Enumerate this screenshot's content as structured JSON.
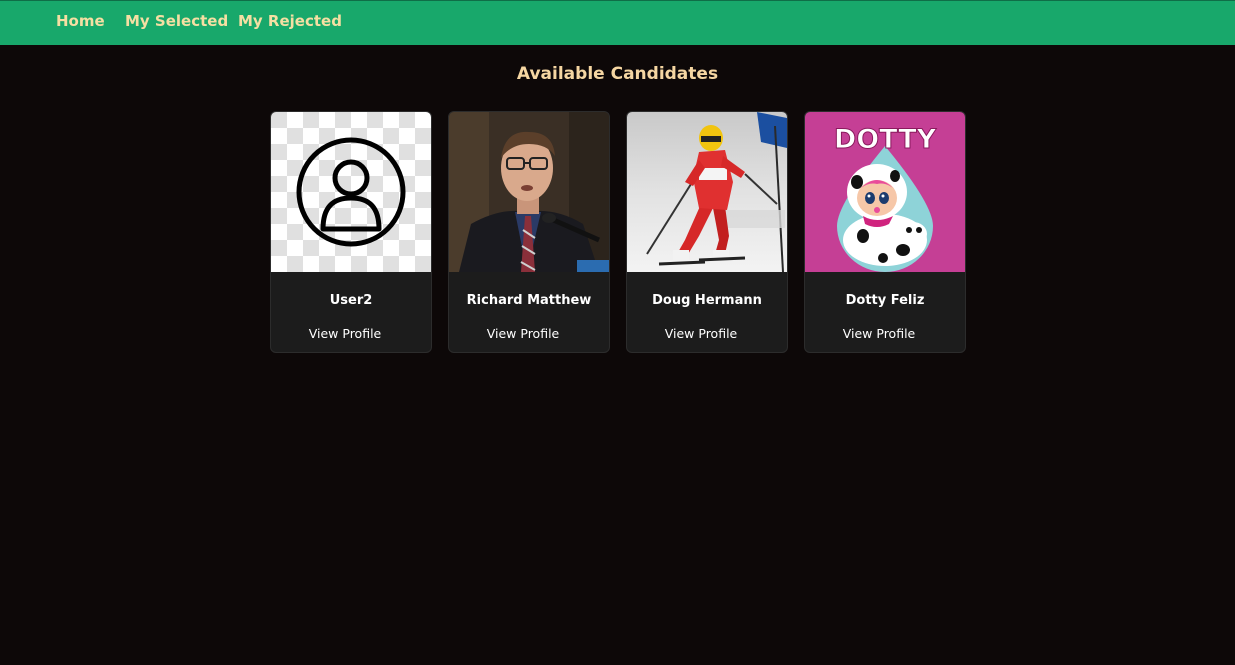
{
  "nav": {
    "home": "Home",
    "selected": "My Selected",
    "rejected": "My Rejected"
  },
  "page": {
    "title": "Available Candidates"
  },
  "candidates": [
    {
      "name": "User2",
      "link": "View Profile",
      "photo": "default-user-avatar"
    },
    {
      "name": "Richard Matthew",
      "link": "View Profile",
      "photo": "man-speaking-at-microphone"
    },
    {
      "name": "Doug Hermann",
      "link": "View Profile",
      "photo": "skier-racing-downhill"
    },
    {
      "name": "Dotty Feliz",
      "photo_text": "DOTTY",
      "link": "View Profile",
      "photo": "cartoon-doll-with-dalmatian"
    }
  ],
  "colors": {
    "navbar": "#18a86b",
    "nav_text": "#f5dfa3",
    "title_text": "#f5d6a2",
    "background": "#0d0808",
    "card": "#1c1c1c"
  }
}
